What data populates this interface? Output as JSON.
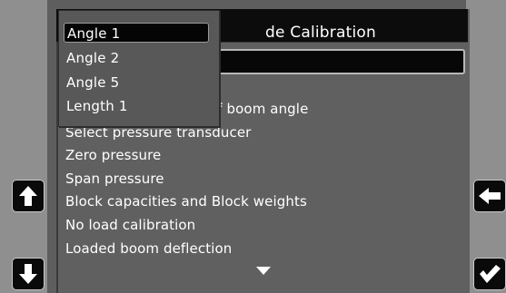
{
  "screen": {
    "title": "de Calibration"
  },
  "dropdown": {
    "options": [
      {
        "label": "Angle 1",
        "selected": true
      },
      {
        "label": "Angle 2",
        "selected": false
      },
      {
        "label": "Angle 5",
        "selected": false
      },
      {
        "label": "Length 1",
        "selected": false
      }
    ]
  },
  "menu": {
    "items": [
      "of boom angle",
      "Select pressure transducer",
      "Zero pressure",
      "Span pressure",
      "Block capacities and Block weights",
      "No load calibration",
      "Loaded boom deflection"
    ]
  },
  "buttons": {
    "scroll_up": {
      "icon": "arrow-up-icon"
    },
    "scroll_down": {
      "icon": "arrow-down-icon"
    },
    "back": {
      "icon": "arrow-left-icon"
    },
    "confirm": {
      "icon": "checkmark-icon"
    }
  }
}
